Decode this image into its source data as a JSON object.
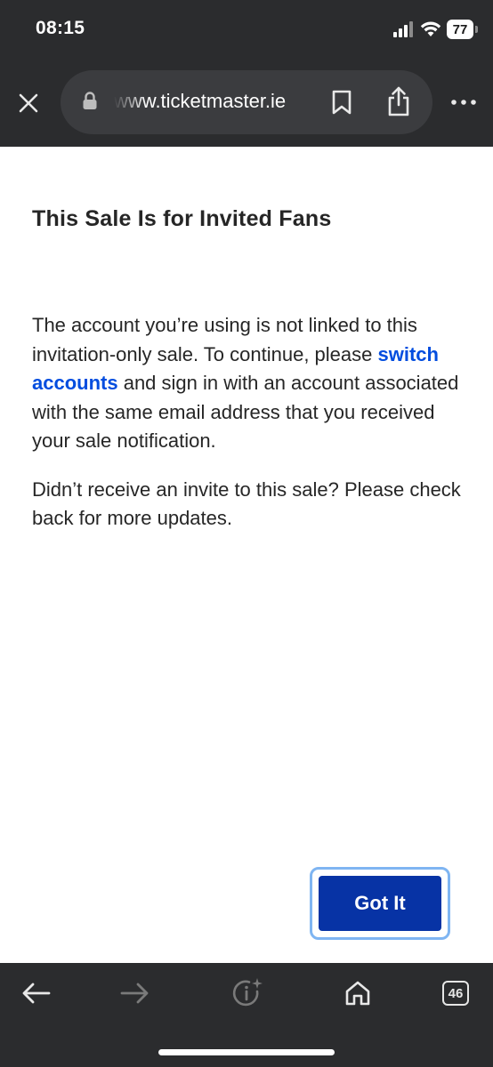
{
  "status_bar": {
    "time": "08:15",
    "battery": "77",
    "icons": [
      "signal-icon",
      "wifi-icon",
      "battery-icon"
    ]
  },
  "browser": {
    "url": "www.ticketmaster.ie",
    "icons": [
      "close-icon",
      "lock-icon",
      "bookmark-icon",
      "share-icon",
      "more-icon"
    ]
  },
  "modal": {
    "title": "This Sale Is for Invited Fans",
    "para1_before": "The account you’re using is not linked to this invitation-only sale. To continue, please ",
    "para1_link": "switch accounts",
    "para1_after": " and sign in with an account associated with the same email address that you received your sale notification.",
    "para2": "Didn’t receive an invite to this sale? Please check back for more updates.",
    "button_label": "Got It"
  },
  "toolbar": {
    "tab_count": "46",
    "icons": [
      "back-arrow-icon",
      "forward-arrow-icon",
      "info-sparkle-icon",
      "home-icon",
      "tabs-icon"
    ]
  },
  "colors": {
    "chrome_bg": "#2b2c2e",
    "url_bar_bg": "#3b3c3f",
    "link": "#024ddf",
    "button_bg": "#0733a5",
    "focus_ring": "#7fb5f2"
  }
}
